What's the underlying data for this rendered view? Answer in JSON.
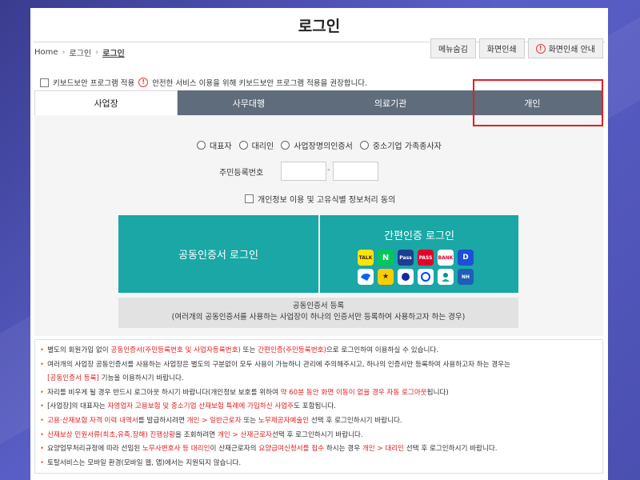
{
  "page_title": "로그인",
  "breadcrumb": [
    "Home",
    "로그인",
    "로그인"
  ],
  "top_buttons": [
    "메뉴숨김",
    "화면인쇄",
    "화면인쇄 안내"
  ],
  "keyboard_security": "키보드보안 프로그램 적용",
  "keyboard_notice": "안전한 서비스 이용을 위해 키보드보안 프로그램 적용을 권장합니다.",
  "tabs": [
    "사업장",
    "사무대행",
    "의료기관",
    "개인"
  ],
  "user_types": [
    "대표자",
    "대리인",
    "사업장명의인증서",
    "중소기업 가족종사자"
  ],
  "ssn_label": "주민등록번호",
  "ssn_dash": "-",
  "agree_label": "개인정보 이용 및 고유식별 정보처리 동의",
  "joint_cert_login": "공동인증서 로그인",
  "simple_auth_login": "간편인증 로그인",
  "auth_apps": [
    "TALK",
    "N",
    "Pass",
    "PASS",
    "BANK",
    "D",
    "",
    "★",
    "",
    "",
    "",
    "NH"
  ],
  "cert_register_title": "공동인증서 등록",
  "cert_register_desc": "(여러개의 공동인증서를 사용하는 사업장이 하나의 인증서만 등록하여 사용하고자 하는 경우)",
  "notices": {
    "n1": {
      "a": "별도의 회원가입 없이 ",
      "b": "공동인증서(주민등록번호 및 사업자등록번호)",
      "c": " 또는 ",
      "d": "간편인증(주민등록번호)",
      "e": "으로 로그인하여 이용하실 수 있습니다."
    },
    "n2": {
      "a": "여러개의 사업장 공동인증서를 사용하는 사업장은 별도의 구분없이 모두 사용이 가능하니 관리에 주의해주시고, 하나의 인증서만 등록하여 사용하고자 하는 경우는"
    },
    "n3": {
      "a": "[공동인증서 등록]",
      "b": " 기능을 이용하시기 바랍니다."
    },
    "n4": {
      "a": "자리를 비우게 될 경우 반드시 로그아웃 하시기 바랍니다(개인정보 보호를 위하여 ",
      "b": "약 60분 동안 화면 이동이 없을 경우 자동 로그아웃",
      "c": "됩니다)"
    },
    "n5": {
      "a": "[사업장]의 대표자는 ",
      "b": "자영업자 고용보험 및 중소기업 산재보험 특례에 가입하신 사업주",
      "c": "도 포함됩니다."
    },
    "n6": {
      "a": "고용·산재보험 자격 이력 내역서",
      "b": "를 발급하시려면 ",
      "c": "개인 > 일반근로자",
      "d": " 또는 ",
      "e": "노무제공자예술인",
      "f": " 선택 후 로그인하시기 바랍니다."
    },
    "n7": {
      "a": "산재보상 민원서류(최초,유족,장해) 진행상황",
      "b": "을 조회하려면 ",
      "c": "개인 > 산재근로자",
      "d": "선택 후 로그인하시기 바랍니다."
    },
    "n8": {
      "a": "요양업무처리규정에 따라 선임된 ",
      "b": "노무사변호사 등 대리인",
      "c": "이 산재근로자의 ",
      "d": "요양급여신청서를 접수",
      "e": " 하시는 경우 ",
      "f": "개인 > 대리인",
      "g": " 선택 후 로그인하시기 바랍니다."
    },
    "n9": {
      "a": "토탈서비스는 모바일 환경(모바일 웹, 앱)에서는 지원되지 않습니다."
    }
  },
  "colors": {
    "accent": "#1aa7a5",
    "tab_bar": "#5e6c7c",
    "highlight": "#e02020"
  }
}
